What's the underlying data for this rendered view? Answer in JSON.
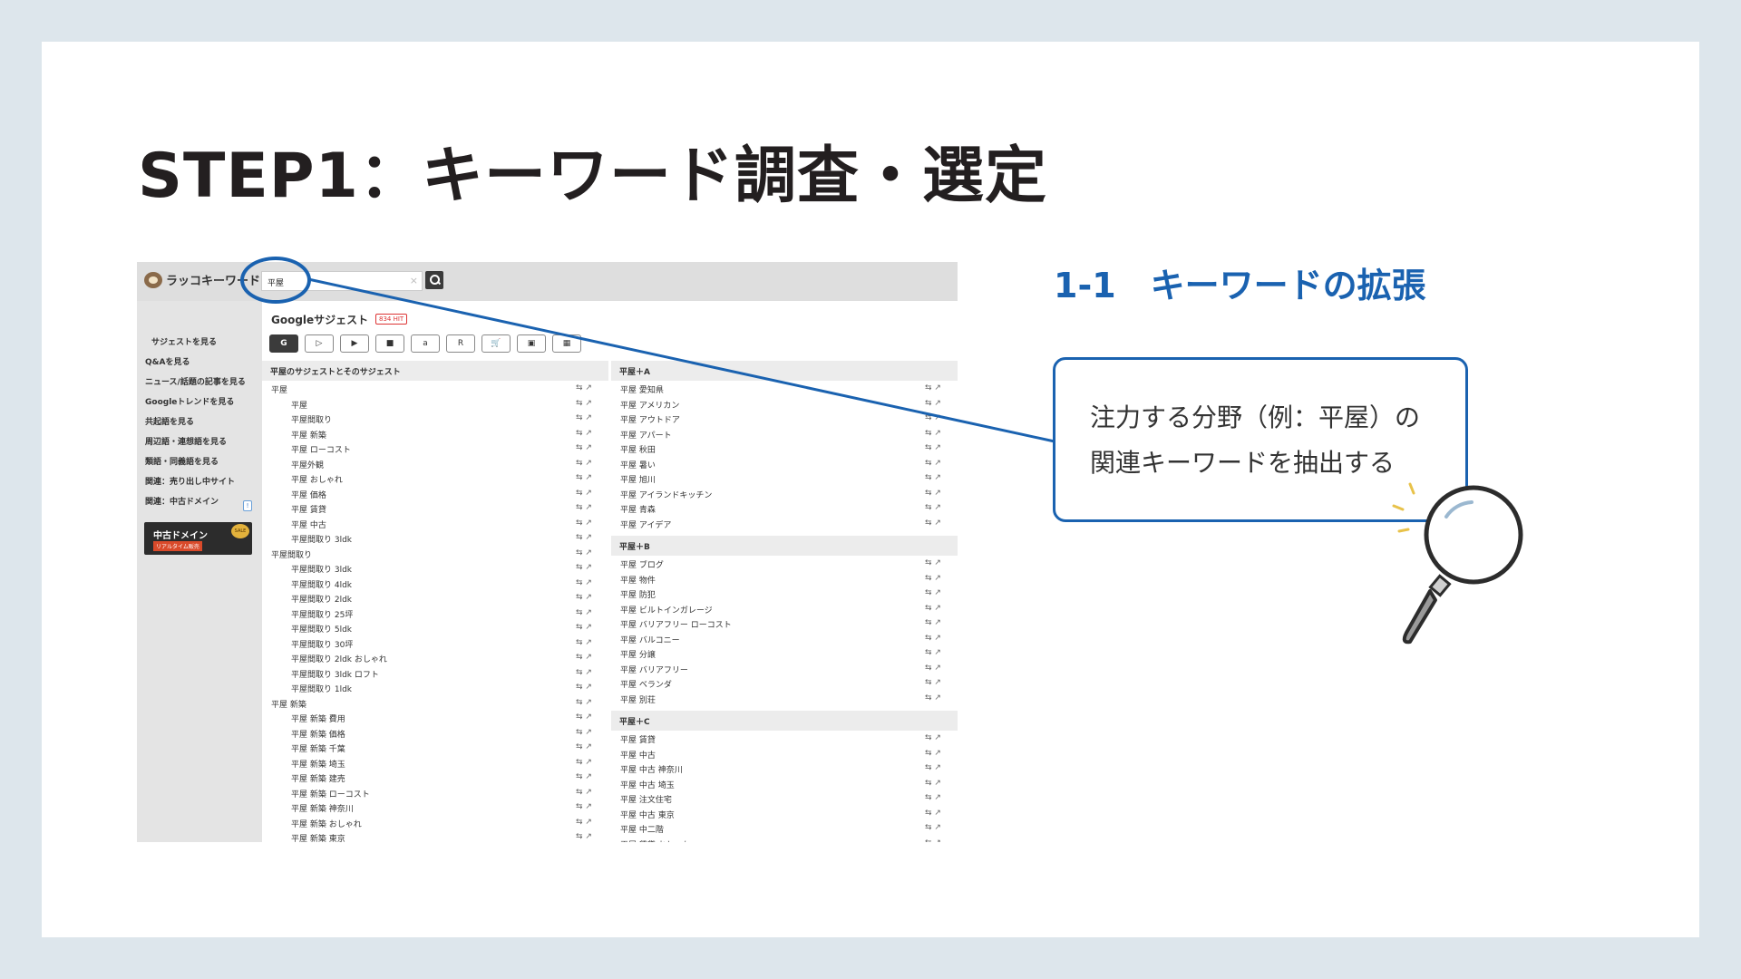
{
  "slide": {
    "title": "STEP1：キーワード調査・選定",
    "subheading": "1-1　キーワードの拡張",
    "callout_lines": [
      "注力する分野（例：平屋）の",
      "関連キーワードを抽出する"
    ]
  },
  "app": {
    "logo_text": "ラッコキーワード",
    "search_value": "平屋",
    "clear_glyph": "×",
    "sidebar": [
      "サジェストを見る",
      "Q&Aを見る",
      "ニュース/話題の記事を見る",
      "Googleトレンドを見る",
      "共起語を見る",
      "周辺語・連想語を見る",
      "類語・同義語を見る",
      "関連：売り出し中サイト",
      "関連：中古ドメイン"
    ],
    "sidebar_badge": "!",
    "banner": {
      "title": "中古ドメイン",
      "sub": "リアルタイム販売",
      "seal": "SALE"
    },
    "section_title": "Googleサジェスト",
    "hit_count": "834 HIT",
    "tool_buttons": [
      "G",
      "▷",
      "▶",
      "■",
      "a",
      "R",
      "🛒",
      "▣",
      "▦"
    ],
    "row_icons": "⇆ ↗",
    "left_column": {
      "header": "平屋のサジェストとそのサジェスト",
      "rows": [
        {
          "text": "平屋",
          "indent": false
        },
        {
          "text": "平屋",
          "indent": true
        },
        {
          "text": "平屋間取り",
          "indent": true
        },
        {
          "text": "平屋 新築",
          "indent": true
        },
        {
          "text": "平屋 ローコスト",
          "indent": true
        },
        {
          "text": "平屋外観",
          "indent": true
        },
        {
          "text": "平屋 おしゃれ",
          "indent": true
        },
        {
          "text": "平屋 価格",
          "indent": true
        },
        {
          "text": "平屋 賃貸",
          "indent": true
        },
        {
          "text": "平屋 中古",
          "indent": true
        },
        {
          "text": "平屋間取り 3ldk",
          "indent": true
        },
        {
          "text": "平屋間取り",
          "indent": false
        },
        {
          "text": "平屋間取り 3ldk",
          "indent": true
        },
        {
          "text": "平屋間取り 4ldk",
          "indent": true
        },
        {
          "text": "平屋間取り 2ldk",
          "indent": true
        },
        {
          "text": "平屋間取り 25坪",
          "indent": true
        },
        {
          "text": "平屋間取り 5ldk",
          "indent": true
        },
        {
          "text": "平屋間取り 30坪",
          "indent": true
        },
        {
          "text": "平屋間取り 2ldk おしゃれ",
          "indent": true
        },
        {
          "text": "平屋間取り 3ldk ロフト",
          "indent": true
        },
        {
          "text": "平屋間取り 1ldk",
          "indent": true
        },
        {
          "text": "平屋 新築",
          "indent": false
        },
        {
          "text": "平屋 新築 費用",
          "indent": true
        },
        {
          "text": "平屋 新築 価格",
          "indent": true
        },
        {
          "text": "平屋 新築 千葉",
          "indent": true
        },
        {
          "text": "平屋 新築 埼玉",
          "indent": true
        },
        {
          "text": "平屋 新築 建売",
          "indent": true
        },
        {
          "text": "平屋 新築 ローコスト",
          "indent": true
        },
        {
          "text": "平屋 新築 神奈川",
          "indent": true
        },
        {
          "text": "平屋 新築 おしゃれ",
          "indent": true
        },
        {
          "text": "平屋 新築 東京",
          "indent": true
        }
      ]
    },
    "right_column": {
      "groups": [
        {
          "header": "平屋＋A",
          "rows": [
            "平屋 愛知県",
            "平屋 アメリカン",
            "平屋 アウトドア",
            "平屋 アパート",
            "平屋 秋田",
            "平屋 暑い",
            "平屋 旭川",
            "平屋 アイランドキッチン",
            "平屋 青森",
            "平屋 アイデア"
          ]
        },
        {
          "header": "平屋＋B",
          "rows": [
            "平屋 ブログ",
            "平屋 物件",
            "平屋 防犯",
            "平屋 ビルトインガレージ",
            "平屋 バリアフリー ローコスト",
            "平屋 バルコニー",
            "平屋 分譲",
            "平屋 バリアフリー",
            "平屋 ベランダ",
            "平屋 別荘"
          ]
        },
        {
          "header": "平屋＋C",
          "rows": [
            "平屋 賃貸",
            "平屋 中古",
            "平屋 中古 神奈川",
            "平屋 中古 埼玉",
            "平屋 注文住宅",
            "平屋 中古 東京",
            "平屋 中二階",
            "平屋 賃貸 おしゃれ"
          ]
        }
      ]
    }
  },
  "colors": {
    "accent": "#1a62b0",
    "background": "#dde6ec",
    "title": "#231f20"
  }
}
